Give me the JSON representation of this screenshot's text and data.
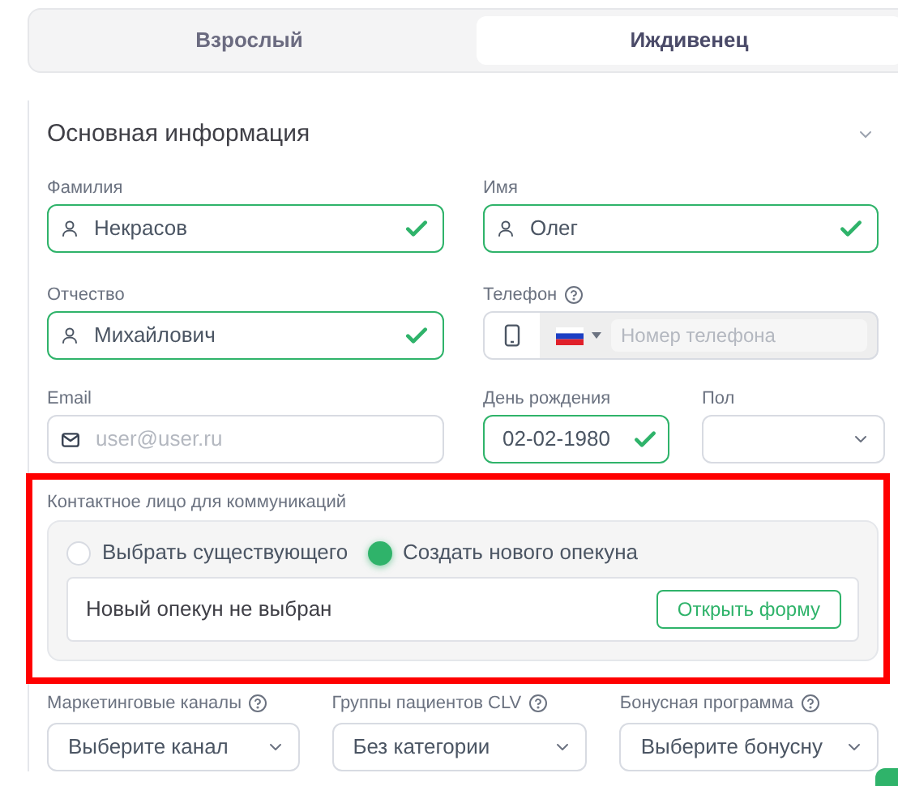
{
  "tabs": [
    {
      "label": "Взрослый",
      "selected": false
    },
    {
      "label": "Иждивенец",
      "selected": true
    }
  ],
  "section": {
    "title": "Основная информация",
    "expanded": true
  },
  "fields": [
    {
      "label": "Фамилия",
      "kind": "text",
      "value": "Некрасов",
      "valid": true
    },
    {
      "label": "Имя",
      "kind": "text",
      "value": "Олег",
      "valid": true
    },
    {
      "label": "Отчество",
      "kind": "text",
      "value": "Михайлович",
      "valid": true
    },
    {
      "label": "Телефон",
      "kind": "phone",
      "help": true,
      "placeholder": "Номер телефона",
      "valid": false
    },
    {
      "label": "Email",
      "kind": "email",
      "placeholder": "user@user.ru",
      "valid": false
    },
    {
      "label": "День рождения",
      "kind": "date",
      "value": "02-02-1980",
      "valid": true
    },
    {
      "label": "Пол",
      "kind": "select",
      "valid": false
    }
  ],
  "contact": {
    "label": "Контактное лицо для коммуникаций",
    "highlighted": true,
    "options": [
      {
        "label": "Выбрать существующего",
        "selected": false
      },
      {
        "label": "Создать нового опекуна",
        "selected": true
      }
    ],
    "status": "Новый опекун не выбран",
    "button": "Открыть форму"
  },
  "selects": [
    {
      "label": "Маркетинговые каналы",
      "help": true,
      "placeholder": "Выберите канал"
    },
    {
      "label": "Группы пациентов CLV",
      "help": true,
      "value": "Без категории"
    },
    {
      "label": "Бонусная программа",
      "help": true,
      "placeholder": "Выберите бонусну"
    }
  ]
}
